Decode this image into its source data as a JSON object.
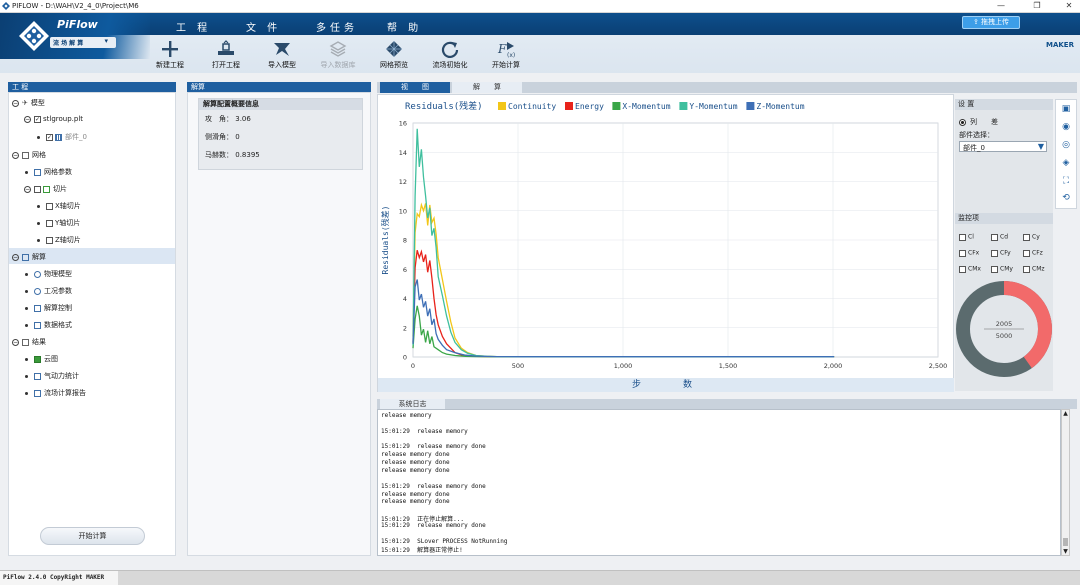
{
  "window": {
    "title": "PIFLOW - D:\\WAH\\V2_4_0\\Project\\M6",
    "minimize": "—",
    "restore": "❐",
    "close": "✕"
  },
  "brand": {
    "name": "PiFlow",
    "mode": "流 场 解 算"
  },
  "menu": [
    "工 程",
    "文 件",
    "多任务",
    "帮 助"
  ],
  "upload_label": "拖拽上传",
  "maker_label": "MAKER",
  "toolbar": [
    {
      "label": "新建工程",
      "icon": "plus-icon",
      "enabled": true
    },
    {
      "label": "打开工程",
      "icon": "open-project-icon",
      "enabled": true
    },
    {
      "label": "导入模型",
      "icon": "import-model-icon",
      "enabled": true
    },
    {
      "label": "导入数据库",
      "icon": "import-database-icon",
      "enabled": false
    },
    {
      "label": "网格预览",
      "icon": "mesh-preview-icon",
      "enabled": true
    },
    {
      "label": "流场初始化",
      "icon": "refresh-icon",
      "enabled": true
    },
    {
      "label": "开始计算",
      "icon": "start-compute-icon",
      "enabled": true
    }
  ],
  "project_panel": {
    "header": "工 程",
    "model": "模型",
    "file": "stlgroup.plt",
    "part": "部件_0",
    "mesh": "网格",
    "mesh_params": "网格参数",
    "slice": "切片",
    "x_slice": "X轴切片",
    "y_slice": "Y轴切片",
    "z_slice": "Z轴切片",
    "solve": "解算",
    "physics": "物理模型",
    "conditions": "工况参数",
    "control": "解算控制",
    "format": "数据格式",
    "results": "结果",
    "contour": "云图",
    "aero": "气动力统计",
    "report": "流场计算报告",
    "start_button": "开始计算"
  },
  "solve_panel": {
    "header": "解算",
    "info_title": "解算配置概要信息",
    "attack_label": "攻　角：",
    "attack_value": "3.06",
    "side_label": "侧滑角：",
    "side_value": "0",
    "mach_label": "马赫数：",
    "mach_value": "0.8395"
  },
  "tabs": [
    "视　　图",
    "解　　算"
  ],
  "chart_data": {
    "type": "line",
    "title": "Residuals(残差)",
    "xlabel": "步　　数",
    "ylabel": "Residuals(残差)",
    "xlim": [
      0,
      2500
    ],
    "ylim": [
      0,
      16
    ],
    "xticks": [
      "0",
      "500",
      "1,000",
      "1,500",
      "2,000",
      "2,500"
    ],
    "yticks": [
      "0",
      "2",
      "4",
      "6",
      "8",
      "10",
      "12",
      "14",
      "16"
    ],
    "grid": true,
    "legend_position": "top",
    "series": [
      {
        "name": "Continuity",
        "color": "#f2c618",
        "x": [
          0,
          10,
          20,
          30,
          40,
          50,
          60,
          70,
          80,
          90,
          100,
          110,
          120,
          140,
          160,
          180,
          200,
          230,
          260,
          300,
          350,
          400,
          500,
          700,
          1000,
          2005
        ],
        "y": [
          1.4,
          8.5,
          9.8,
          9.6,
          10.4,
          10.0,
          10.5,
          9.0,
          10.4,
          9.2,
          9.5,
          8.4,
          6.8,
          5.3,
          3.8,
          2.4,
          1.3,
          0.6,
          0.3,
          0.1,
          0.05,
          0.03,
          0.02,
          0.02,
          0.02,
          0.02
        ]
      },
      {
        "name": "Energy",
        "color": "#e8231b",
        "x": [
          0,
          10,
          20,
          30,
          40,
          50,
          60,
          70,
          80,
          90,
          100,
          110,
          120,
          140,
          160,
          180,
          200,
          230,
          260,
          300,
          350,
          400,
          500,
          700,
          1000,
          2005
        ],
        "y": [
          1.0,
          6.1,
          7.3,
          6.8,
          7.2,
          6.5,
          7.0,
          5.8,
          6.6,
          5.4,
          4.0,
          2.9,
          2.2,
          1.4,
          0.9,
          0.6,
          0.3,
          0.15,
          0.1,
          0.05,
          0.03,
          0.02,
          0.02,
          0.02,
          0.02,
          0.02
        ]
      },
      {
        "name": "X-Momentum",
        "color": "#3aa648",
        "x": [
          0,
          10,
          20,
          30,
          40,
          50,
          60,
          70,
          80,
          90,
          100,
          120,
          140,
          160,
          200,
          250,
          300,
          400,
          500,
          700,
          1000,
          2005
        ],
        "y": [
          0.6,
          2.6,
          3.5,
          2.8,
          1.5,
          1.9,
          1.0,
          1.8,
          0.9,
          1.4,
          0.7,
          0.5,
          0.3,
          0.2,
          0.1,
          0.05,
          0.03,
          0.02,
          0.02,
          0.02,
          0.02,
          0.02
        ]
      },
      {
        "name": "Y-Momentum",
        "color": "#3fbf9e",
        "x": [
          0,
          10,
          20,
          30,
          40,
          50,
          60,
          70,
          80,
          90,
          100,
          110,
          120,
          140,
          160,
          180,
          200,
          230,
          260,
          300,
          350,
          400,
          500,
          700,
          1000,
          2005
        ],
        "y": [
          0.8,
          11.0,
          15.6,
          13.0,
          14.2,
          12.3,
          11.0,
          9.5,
          10.2,
          8.3,
          8.8,
          7.5,
          5.5,
          4.2,
          2.8,
          1.7,
          1.0,
          0.5,
          0.25,
          0.1,
          0.05,
          0.03,
          0.02,
          0.02,
          0.02,
          0.02
        ]
      },
      {
        "name": "Z-Momentum",
        "color": "#3e6fb6",
        "x": [
          0,
          10,
          20,
          30,
          40,
          50,
          60,
          70,
          80,
          90,
          100,
          110,
          120,
          140,
          160,
          200,
          250,
          300,
          400,
          500,
          700,
          1000,
          2005
        ],
        "y": [
          0.9,
          4.8,
          5.3,
          3.9,
          4.3,
          3.4,
          3.8,
          2.8,
          3.3,
          2.2,
          2.6,
          1.6,
          1.2,
          0.8,
          0.5,
          0.3,
          0.12,
          0.06,
          0.03,
          0.02,
          0.02,
          0.02,
          0.02
        ]
      }
    ]
  },
  "settings": {
    "header": "设 置",
    "radio_label": "列　　差",
    "part_select_label": "部件选择：",
    "part_selected": "部件_0"
  },
  "monitor": {
    "header": "监控项",
    "items": [
      "Cl",
      "Cd",
      "Cy",
      "CFx",
      "CFy",
      "CFz",
      "CMx",
      "CMy",
      "CMz"
    ],
    "progress_current": "2005",
    "progress_total": "5000",
    "progress_fraction": 0.401,
    "progress_color": "#f26a6a",
    "track_color": "#5b6b6e"
  },
  "log": {
    "tab": "系统日志",
    "lines": [
      "release memory",
      "",
      "15:01:29  release memory",
      "",
      "15:01:29  release memory done",
      "release memory done",
      "release memory done",
      "release memory done",
      "",
      "15:01:29  release memory done",
      "release memory done",
      "release memory done",
      "",
      "15:01:29  正在停止解算...",
      "15:01:29  release memory done",
      "",
      "15:01:29  SLover PROCESS NotRunning",
      "15:01:29  解算器正常停止!"
    ]
  },
  "statusbar": "PiFlow 2.4.0 CopyRight MAKER"
}
